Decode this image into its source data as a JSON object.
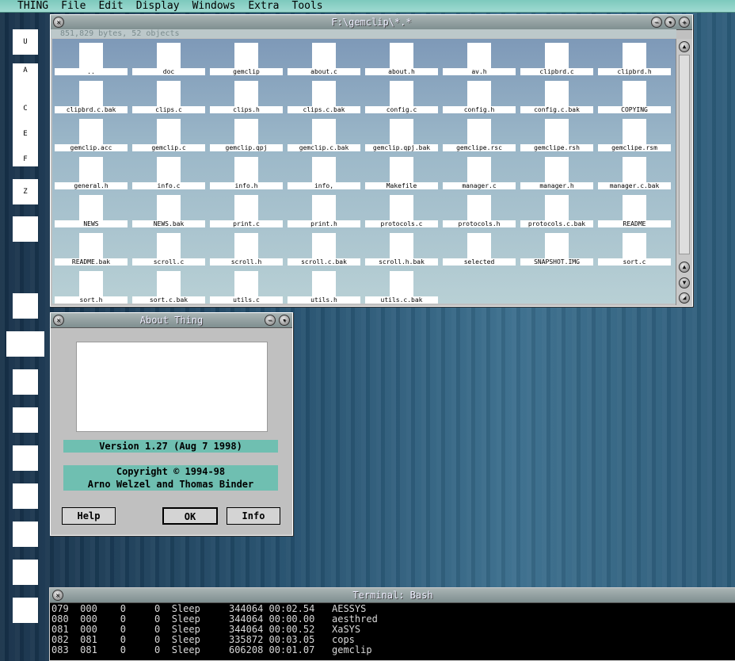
{
  "menubar": {
    "items": [
      "THING",
      "File",
      "Edit",
      "Display",
      "Windows",
      "Extra",
      "Tools"
    ]
  },
  "desktop": {
    "drives_top": [
      {
        "label": "U"
      },
      {
        "label": "A"
      },
      {
        "label": "C"
      },
      {
        "label": "E"
      },
      {
        "label": "F"
      },
      {
        "label": "Z"
      }
    ]
  },
  "file_window": {
    "title": "F:\\gemclip\\*.*",
    "info": "851,829 bytes, 52 objects",
    "files": [
      "..",
      "doc",
      "gemclip",
      "about.c",
      "about.h",
      "av.h",
      "clipbrd.c",
      "clipbrd.h",
      "clipbrd.c.bak",
      "clips.c",
      "clips.h",
      "clips.c.bak",
      "config.c",
      "config.h",
      "config.c.bak",
      "COPYING",
      "gemclip.acc",
      "gemclip.c",
      "gemclip.qpj",
      "gemclip.c.bak",
      "gemclip.qpj.bak",
      "gemclipe.rsc",
      "gemclipe.rsh",
      "gemclipe.rsm",
      "general.h",
      "info.c",
      "info.h",
      "info,",
      "Makefile",
      "manager.c",
      "manager.h",
      "manager.c.bak",
      "NEWS",
      "NEWS.bak",
      "print.c",
      "print.h",
      "protocols.c",
      "protocols.h",
      "protocols.c.bak",
      "README",
      "README.bak",
      "scroll.c",
      "scroll.h",
      "scroll.c.bak",
      "scroll.h.bak",
      "selected",
      "SNAPSHOT.IMG",
      "sort.c",
      "sort.h",
      "sort.c.bak",
      "utils.c",
      "utils.h",
      "utils.c.bak"
    ]
  },
  "about_dialog": {
    "title": "About Thing",
    "version": "Version 1.27 (Aug  7 1998)",
    "copyright_line1": "Copyright © 1994-98",
    "copyright_line2": "Arno Welzel and Thomas Binder",
    "help_label": "Help",
    "ok_label": "OK",
    "info_label": "Info"
  },
  "terminal": {
    "title": "Terminal: Bash",
    "rows": [
      "079  000    0     0  Sleep     344064 00:02.54   AESSYS",
      "080  000    0     0  Sleep     344064 00:00.00   aesthred",
      "081  000    0     0  Sleep     344064 00:00.52   XaSYS",
      "082  081    0     0  Sleep     335872 00:03.05   cops",
      "083  081    0     0  Sleep     606208 00:01.07   gemclip"
    ]
  },
  "colors": {
    "menubar": "#9fdad1",
    "teal_box": "#6fbfb1",
    "window_face": "#c0c0c0"
  }
}
